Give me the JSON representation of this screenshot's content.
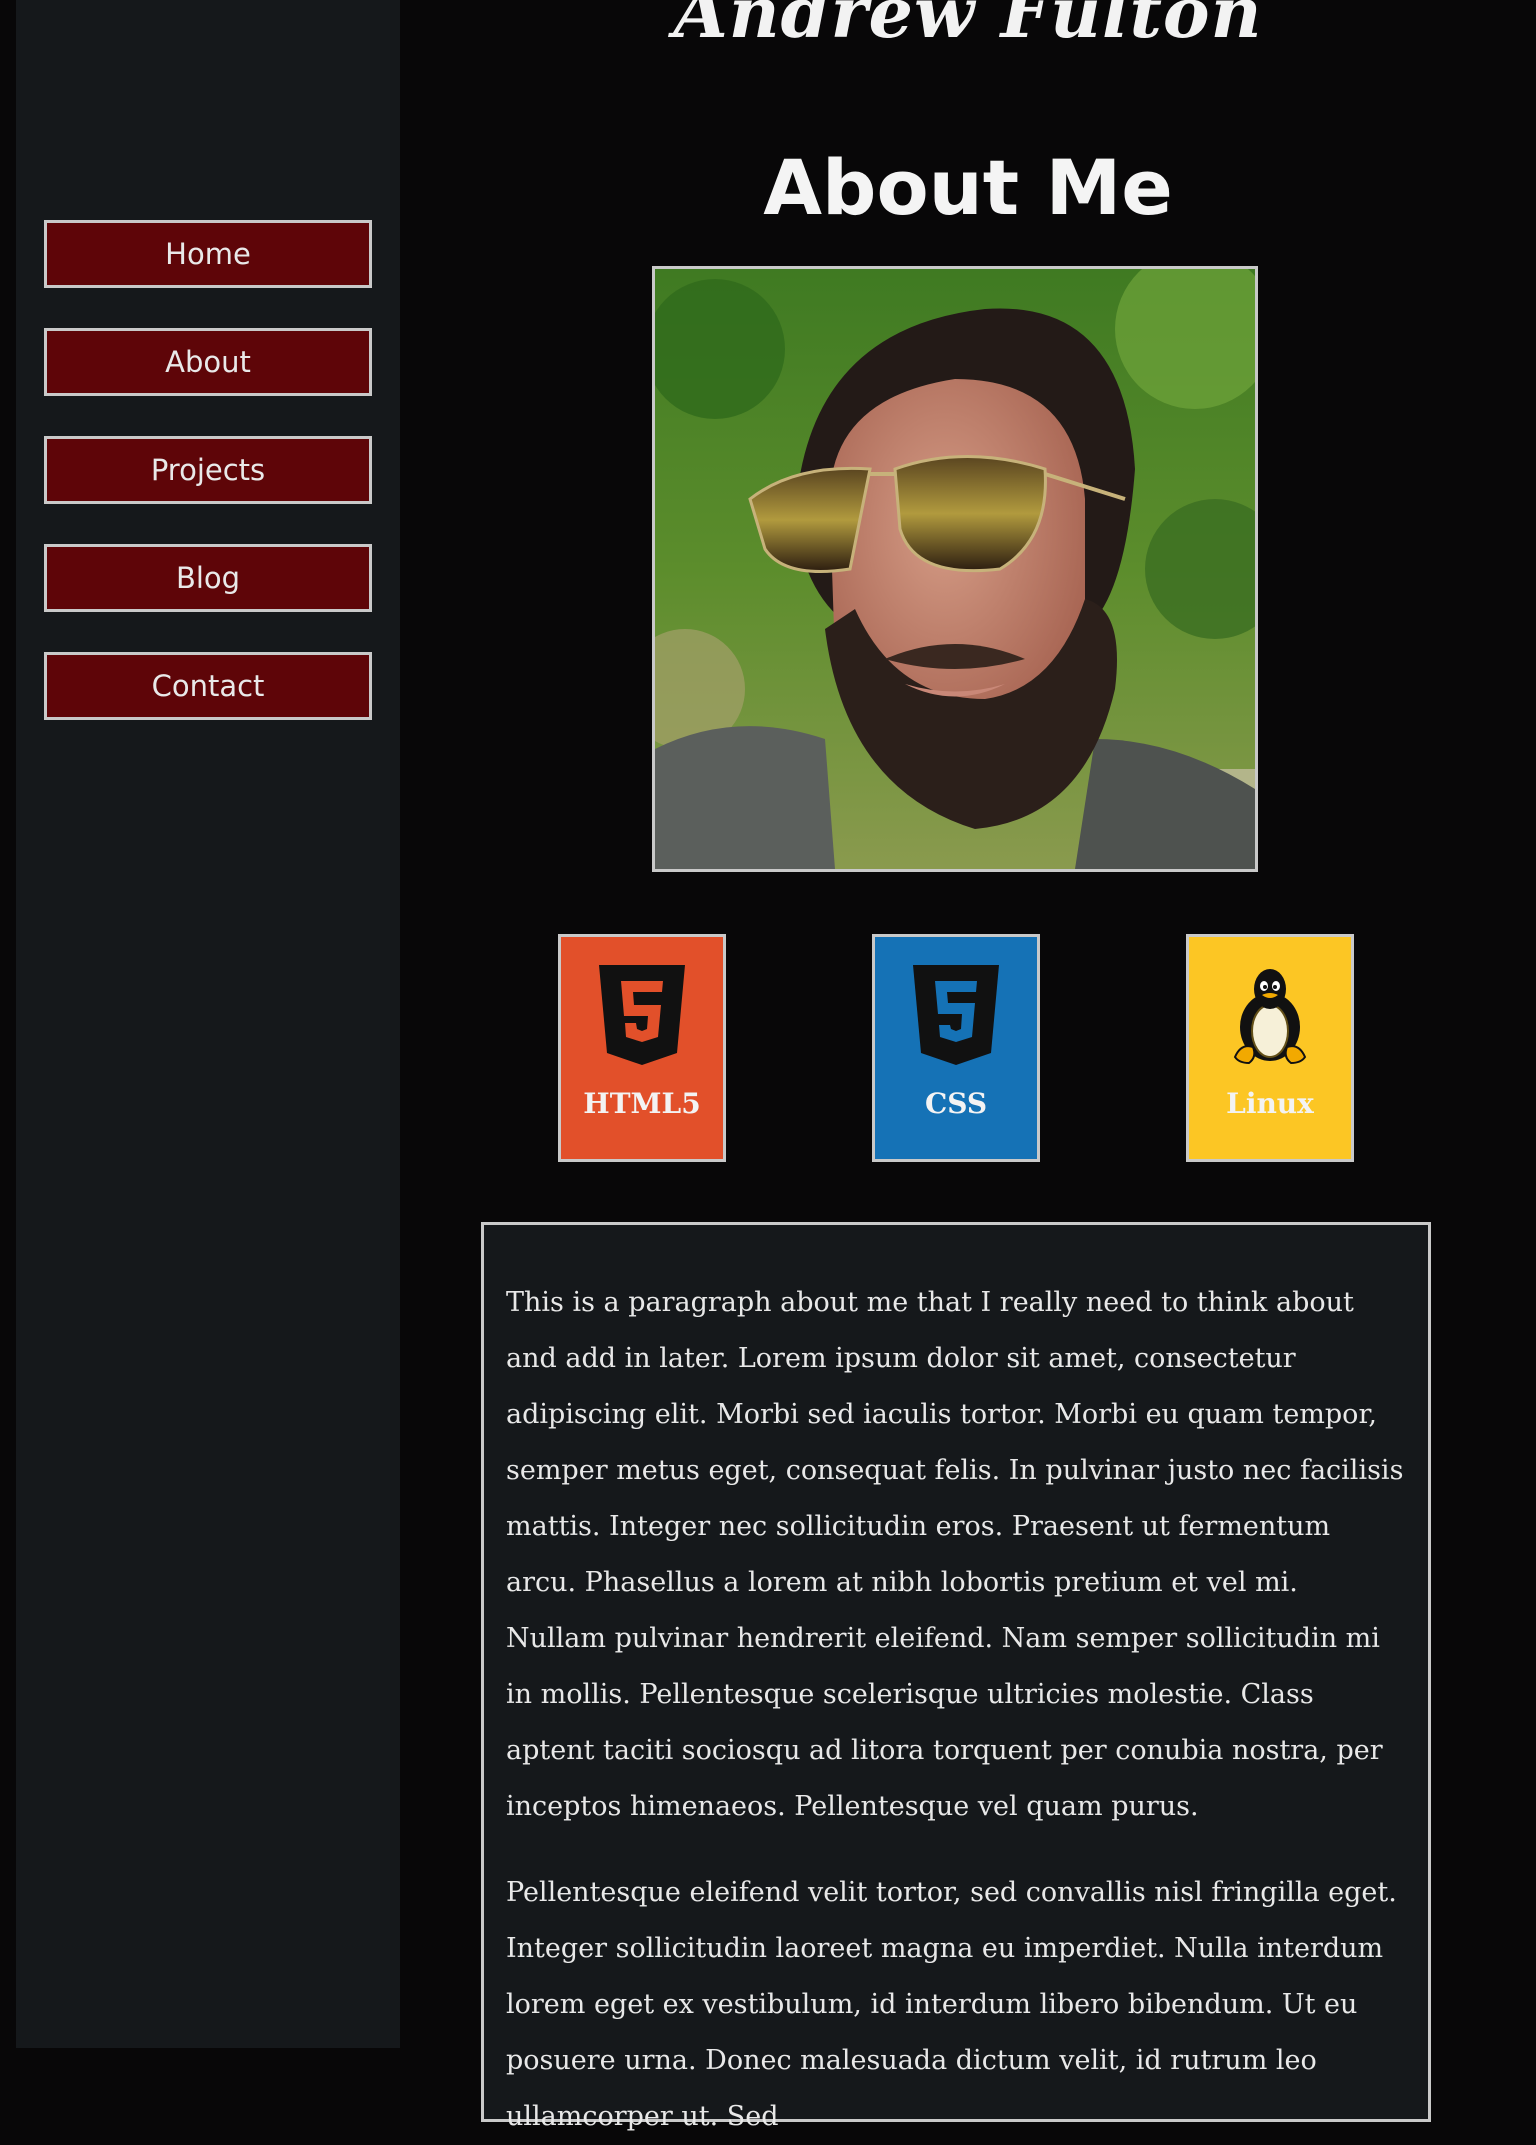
{
  "site": {
    "title": "Andrew Fulton"
  },
  "nav": {
    "items": [
      {
        "label": "Home"
      },
      {
        "label": "About"
      },
      {
        "label": "Projects"
      },
      {
        "label": "Blog"
      },
      {
        "label": "Contact"
      }
    ]
  },
  "page": {
    "heading": "About Me"
  },
  "skills": [
    {
      "label": "HTML5",
      "icon": "html5-icon",
      "color": "#e2502a"
    },
    {
      "label": "CSS",
      "icon": "css3-icon",
      "color": "#1572b6"
    },
    {
      "label": "Linux",
      "icon": "linux-tux-icon",
      "color": "#fcc624"
    }
  ],
  "about": {
    "paragraphs": [
      "This is a paragraph about me that I really need to think about and add in later. Lorem ipsum dolor sit amet, consectetur adipiscing elit. Morbi sed iaculis tortor. Morbi eu quam tempor, semper metus eget, consequat felis. In pulvinar justo nec facilisis mattis. Integer nec sollicitudin eros. Praesent ut fermentum arcu. Phasellus a lorem at nibh lobortis pretium et vel mi. Nullam pulvinar hendrerit eleifend. Nam semper sollicitudin mi in mollis. Pellentesque scelerisque ultricies molestie. Class aptent taciti sociosqu ad litora torquent per conubia nostra, per inceptos himenaeos. Pellentesque vel quam purus.",
      "Pellentesque eleifend velit tortor, sed convallis nisl fringilla eget. Integer sollicitudin laoreet magna eu imperdiet. Nulla interdum lorem eget ex vestibulum, id interdum libero bibendum. Ut eu posuere urna. Donec malesuada dictum velit, id rutrum leo ullamcorper ut. Sed"
    ]
  },
  "colors": {
    "background": "#080708",
    "sidebar": "#15181b",
    "nav_button": "#5e0508",
    "border": "#c9c9c9"
  }
}
